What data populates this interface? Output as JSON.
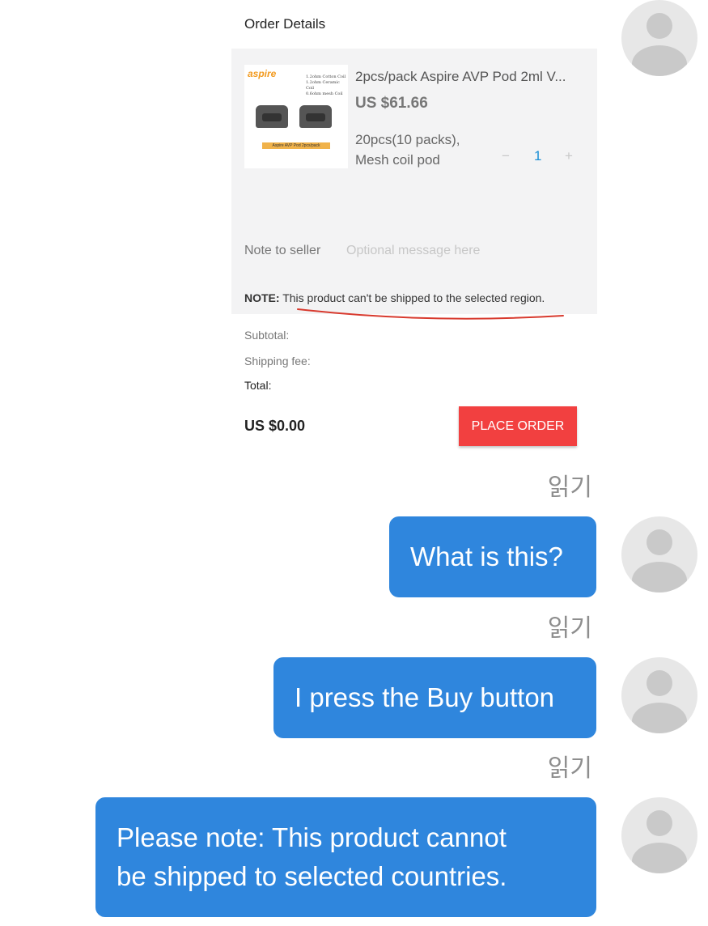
{
  "screenshot": {
    "title": "Order Details",
    "product": {
      "thumb_logo": "aspire",
      "thumb_specs": [
        "1.2ohm Cotton Coil",
        "1.2ohm Ceramic Coil",
        "0.6ohm mesh Coil"
      ],
      "thumb_band": "Aspire AVP Pod   2pcs/pack",
      "name": "2pcs/pack Aspire AVP Pod 2ml V...",
      "price": "US $61.66",
      "variant_line1": "20pcs(10 packs),",
      "variant_line2": "Mesh coil pod",
      "qty_minus": "−",
      "qty": "1",
      "qty_plus": "+"
    },
    "note_label": "Note to seller",
    "note_placeholder": "Optional message here",
    "notice_prefix": "NOTE:",
    "notice_text": " This product can't be shipped to the selected region.",
    "subtotal_label": "Subtotal:",
    "shipping_label": "Shipping fee:",
    "total_label": "Total:",
    "total_value": "US $0.00",
    "place_order": "PLACE ORDER"
  },
  "chat": {
    "read_label": "읽기",
    "messages": [
      {
        "text": "What is this?"
      },
      {
        "text": "I press the Buy button"
      },
      {
        "line1": "Please note: This product cannot",
        "line2": "be shipped to selected countries."
      }
    ]
  },
  "colors": {
    "bubble": "#2f86dd",
    "place_order": "#f24040",
    "underline": "#d83a2e"
  }
}
